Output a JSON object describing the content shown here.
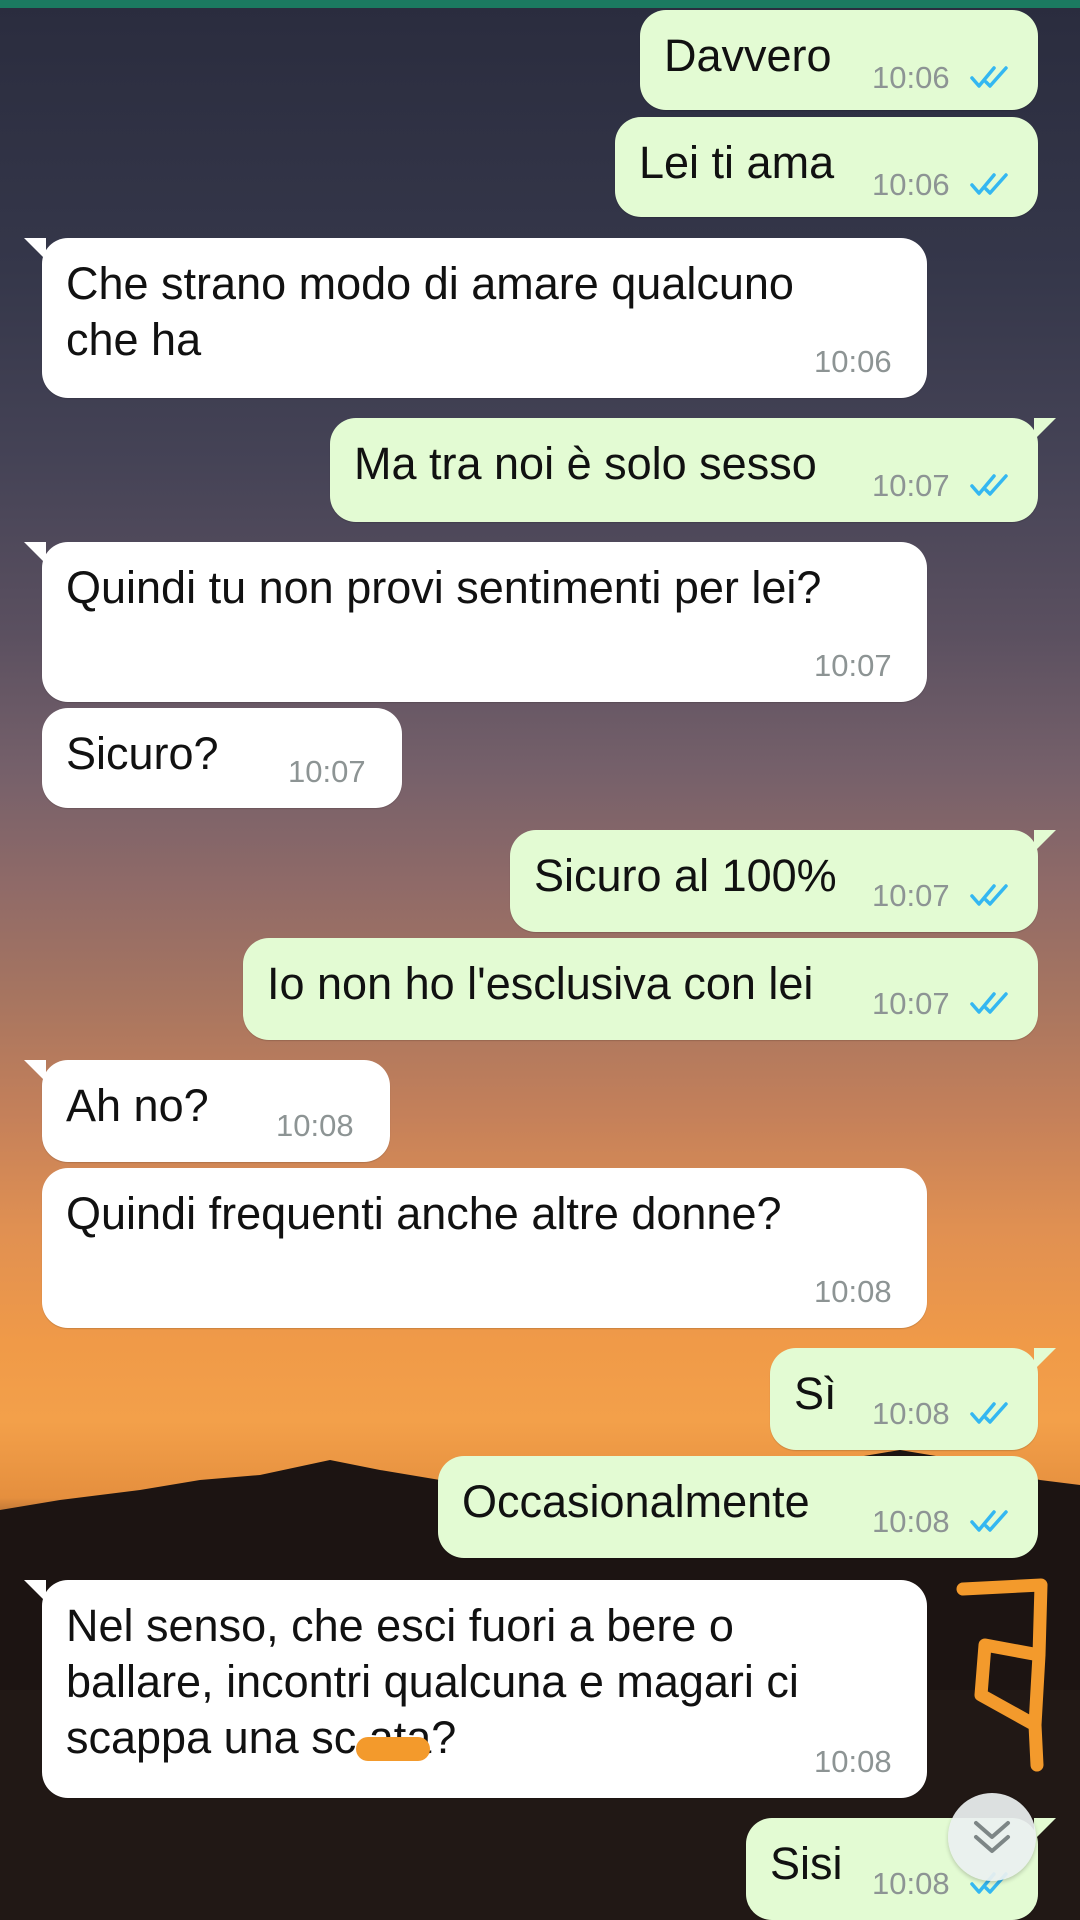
{
  "chat": {
    "messages": [
      {
        "direction": "out",
        "text": "Davvero",
        "time": "10:06",
        "status": "read"
      },
      {
        "direction": "out",
        "text": "Lei ti ama",
        "time": "10:06",
        "status": "read"
      },
      {
        "direction": "in",
        "text": "Che strano modo di amare qualcuno\nche ha",
        "time": "10:06"
      },
      {
        "direction": "out",
        "text": "Ma tra noi è solo sesso",
        "time": "10:07",
        "status": "read"
      },
      {
        "direction": "in",
        "text": "Quindi tu non provi sentimenti per lei?",
        "time": "10:07"
      },
      {
        "direction": "in",
        "text": "Sicuro?",
        "time": "10:07"
      },
      {
        "direction": "out",
        "text": "Sicuro al 100%",
        "time": "10:07",
        "status": "read"
      },
      {
        "direction": "out",
        "text": "Io non ho l'esclusiva con lei",
        "time": "10:07",
        "status": "read"
      },
      {
        "direction": "in",
        "text": "Ah no?",
        "time": "10:08"
      },
      {
        "direction": "in",
        "text": "Quindi frequenti anche altre donne?",
        "time": "10:08"
      },
      {
        "direction": "out",
        "text": "Sì",
        "time": "10:08",
        "status": "read"
      },
      {
        "direction": "out",
        "text": "Occasionalmente",
        "time": "10:08",
        "status": "read"
      },
      {
        "direction": "in",
        "text": "Nel senso, che esci fuori a bere o\nballare, incontri qualcuna e magari ci\nscappa una sc    ata?",
        "time": "10:08"
      },
      {
        "direction": "out",
        "text": "Sisi",
        "time": "10:08",
        "status": "read"
      }
    ]
  },
  "colors": {
    "outgoing_bubble": "#e3fbd3",
    "incoming_bubble": "#ffffff",
    "read_ticks": "#34b7f1",
    "timestamp": "#8d9494",
    "annotation": "#f39a2c"
  },
  "icons": {
    "read_receipt": "double-check-icon",
    "scroll_down": "double-chevron-down-icon"
  }
}
